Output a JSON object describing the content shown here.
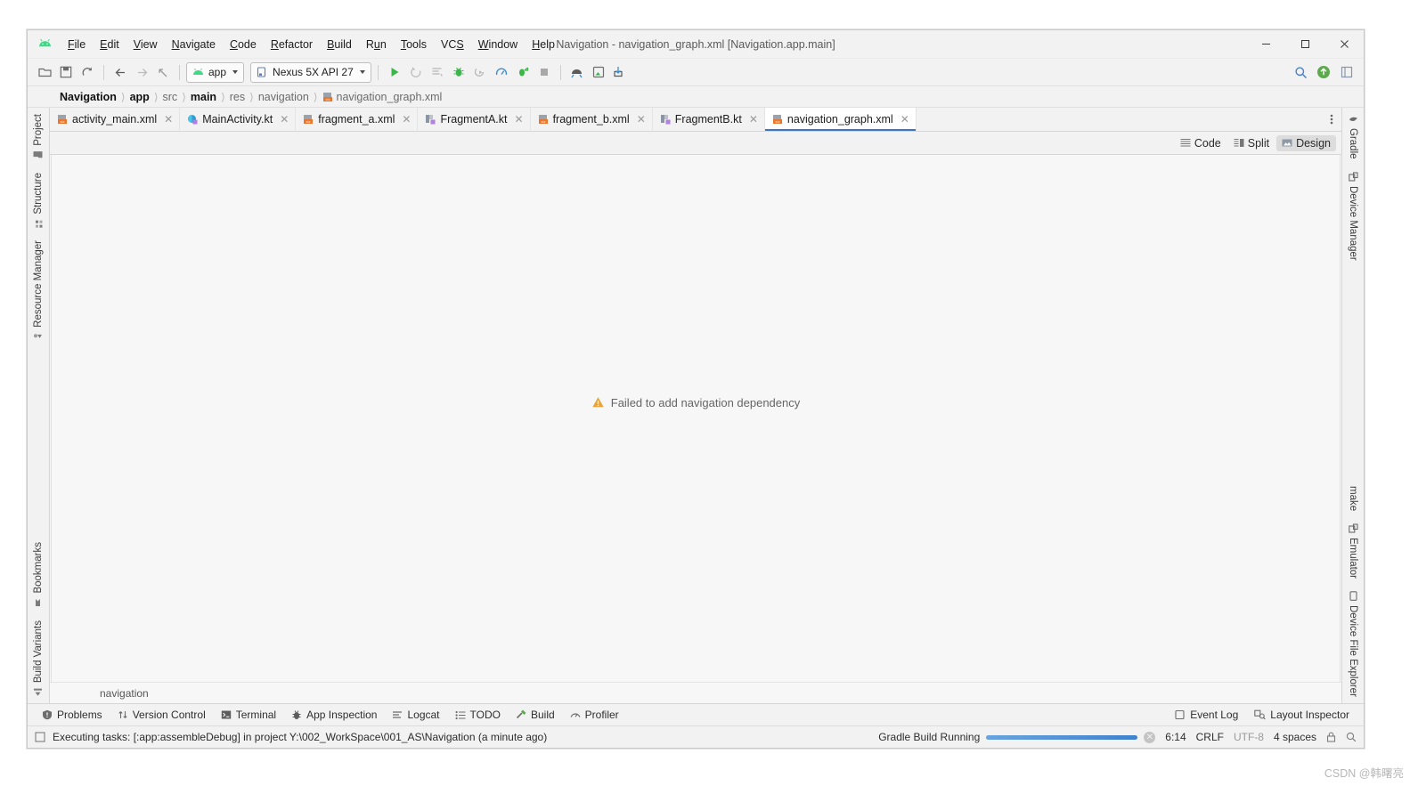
{
  "window": {
    "title": "Navigation - navigation_graph.xml [Navigation.app.main]",
    "minimize": "─",
    "maximize": "□",
    "close": "✕"
  },
  "menu": {
    "items": [
      {
        "label": "File",
        "mnemonic": "F"
      },
      {
        "label": "Edit",
        "mnemonic": "E"
      },
      {
        "label": "View",
        "mnemonic": "V"
      },
      {
        "label": "Navigate",
        "mnemonic": "N"
      },
      {
        "label": "Code",
        "mnemonic": "C"
      },
      {
        "label": "Refactor",
        "mnemonic": "R"
      },
      {
        "label": "Build",
        "mnemonic": "B"
      },
      {
        "label": "Run",
        "mnemonic": "u"
      },
      {
        "label": "Tools",
        "mnemonic": "T"
      },
      {
        "label": "VCS",
        "mnemonic": "S"
      },
      {
        "label": "Window",
        "mnemonic": "W"
      },
      {
        "label": "Help",
        "mnemonic": "H"
      }
    ]
  },
  "toolbar": {
    "module_selector": "app",
    "device_selector": "Nexus 5X API 27",
    "icons": [
      "open-folder-icon",
      "save-icon",
      "sync-project-icon",
      "back-icon",
      "forward-icon",
      "last-edit-location-icon",
      "run-icon",
      "apply-changes-icon",
      "run-with-coverage-icon",
      "debug-icon",
      "attach-debugger-icon",
      "profile-icon",
      "apply-code-changes-icon",
      "stop-icon",
      "sdk-manager-icon",
      "avd-manager-icon",
      "device-manager-icon",
      "search-everywhere-icon",
      "notifications-icon",
      "settings-icon"
    ]
  },
  "breadcrumb": {
    "items": [
      {
        "label": "Navigation",
        "bold": true
      },
      {
        "label": "app",
        "bold": true
      },
      {
        "label": "src",
        "bold": false
      },
      {
        "label": "main",
        "bold": true
      },
      {
        "label": "res",
        "bold": false
      },
      {
        "label": "navigation",
        "bold": false
      },
      {
        "label": "navigation_graph.xml",
        "bold": false,
        "icon": "xml-layout-file-icon"
      }
    ]
  },
  "editor_tabs": [
    {
      "label": "activity_main.xml",
      "icon": "xml-layout-file-icon",
      "active": false
    },
    {
      "label": "MainActivity.kt",
      "icon": "kotlin-class-file-icon",
      "active": false
    },
    {
      "label": "fragment_a.xml",
      "icon": "xml-layout-file-icon",
      "active": false
    },
    {
      "label": "FragmentA.kt",
      "icon": "kotlin-fragment-file-icon",
      "active": false
    },
    {
      "label": "fragment_b.xml",
      "icon": "xml-layout-file-icon",
      "active": false
    },
    {
      "label": "FragmentB.kt",
      "icon": "kotlin-fragment-file-icon",
      "active": false
    },
    {
      "label": "navigation_graph.xml",
      "icon": "xml-layout-file-icon",
      "active": true
    }
  ],
  "tab_close_glyph": "✕",
  "editor_modes": [
    {
      "label": "Code",
      "icon": "code-view-icon",
      "selected": false
    },
    {
      "label": "Split",
      "icon": "split-view-icon",
      "selected": false
    },
    {
      "label": "Design",
      "icon": "design-view-icon",
      "selected": true
    }
  ],
  "canvas": {
    "error_message": "Failed to add navigation dependency",
    "error_icon": "warning-triangle-icon",
    "warning_color": "#e8a33d",
    "status_label": "navigation"
  },
  "left_strip": {
    "top": [
      {
        "label": "Project",
        "icon": "project-icon"
      },
      {
        "label": "Structure",
        "icon": "structure-icon"
      },
      {
        "label": "Resource Manager",
        "icon": "resource-manager-icon"
      }
    ],
    "bottom": [
      {
        "label": "Bookmarks",
        "icon": "bookmarks-icon"
      },
      {
        "label": "Build Variants",
        "icon": "build-variants-icon"
      }
    ]
  },
  "right_strip": {
    "top": [
      {
        "label": "Gradle",
        "icon": "gradle-elephant-icon"
      },
      {
        "label": "Device Manager",
        "icon": "device-manager-icon"
      }
    ],
    "bottom": [
      {
        "label": "make",
        "icon": "make-icon"
      },
      {
        "label": "Emulator",
        "icon": "emulator-icon"
      },
      {
        "label": "Device File Explorer",
        "icon": "device-file-explorer-icon"
      }
    ]
  },
  "tool_windows": [
    {
      "label": "Problems",
      "icon": "problems-icon"
    },
    {
      "label": "Version Control",
      "icon": "version-control-icon"
    },
    {
      "label": "Terminal",
      "icon": "terminal-icon"
    },
    {
      "label": "App Inspection",
      "icon": "app-inspection-icon"
    },
    {
      "label": "Logcat",
      "icon": "logcat-icon"
    },
    {
      "label": "TODO",
      "icon": "todo-icon"
    },
    {
      "label": "Build",
      "icon": "build-hammer-icon"
    },
    {
      "label": "Profiler",
      "icon": "profiler-icon"
    }
  ],
  "tool_windows_right": [
    {
      "label": "Event Log",
      "icon": "event-log-icon"
    },
    {
      "label": "Layout Inspector",
      "icon": "layout-inspector-icon"
    }
  ],
  "status_bar": {
    "message": "Executing tasks: [:app:assembleDebug] in project Y:\\002_WorkSpace\\001_AS\\Navigation (a minute ago)",
    "message_icon": "background-task-icon",
    "progress_label": "Gradle Build Running",
    "progress_percent": 100,
    "progress_color": "#3f82cc",
    "cancel_glyph": "✕",
    "caret_position": "6:14",
    "line_separator": "CRLF",
    "encoding": "UTF-8",
    "indent": "4 spaces",
    "lock_icon": "read-only-lock-icon",
    "inspection_icon": "inspection-level-icon"
  },
  "watermark": "CSDN @韩曙亮"
}
